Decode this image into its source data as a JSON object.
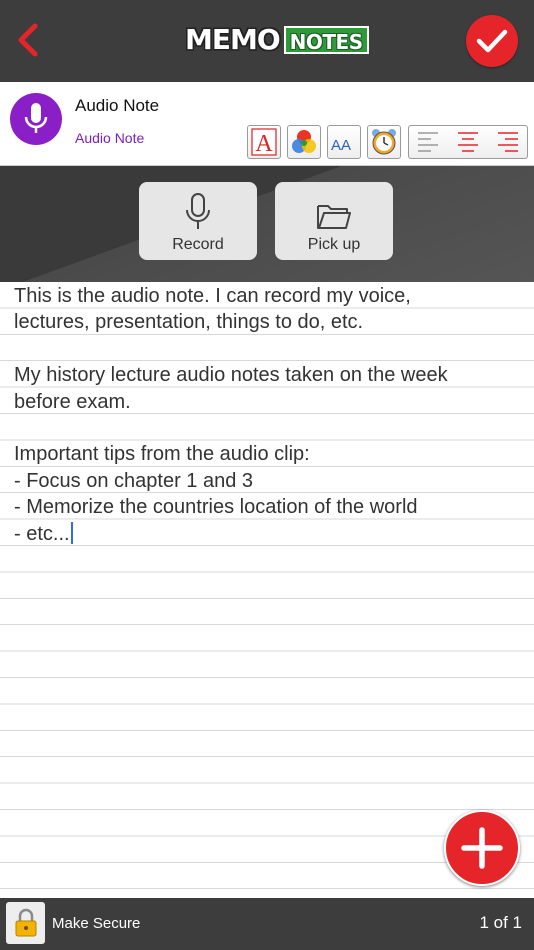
{
  "topbar": {
    "logo_memo": "MEMO",
    "logo_notes": "NOTES"
  },
  "note": {
    "title": "Audio Note",
    "category": "Audio Note",
    "lines": [
      "This is the audio note. I can record my voice,",
      "lectures, presentation, things to do, etc.",
      "",
      "My history lecture audio notes taken on the week",
      "before exam.",
      "",
      "Important tips from the audio clip:",
      "- Focus on chapter 1 and 3",
      "- Memorize the countries location of the world",
      "- etc..."
    ]
  },
  "toolbar": {
    "font_icon_letter": "A",
    "size_icon_letters": "AA"
  },
  "recorder": {
    "record_label": "Record",
    "pickup_label": "Pick up"
  },
  "bottombar": {
    "secure_label": "Make Secure",
    "page_indicator": "1 of 1"
  },
  "colors": {
    "bar_bg": "#3d3d3d",
    "accent_red": "#e5252a",
    "mic_purple": "#8b1fc7",
    "category_purple": "#7a1fb8",
    "logo_green": "#2e9a3a",
    "cursor_blue": "#2c6df0"
  },
  "icons": [
    "back-chevron-icon",
    "checkmark-icon",
    "microphone-icon",
    "font-color-icon",
    "palette-icon",
    "font-size-icon",
    "alarm-clock-icon",
    "align-left-icon",
    "align-center-icon",
    "align-right-icon",
    "folder-icon",
    "plus-icon",
    "lock-icon"
  ]
}
